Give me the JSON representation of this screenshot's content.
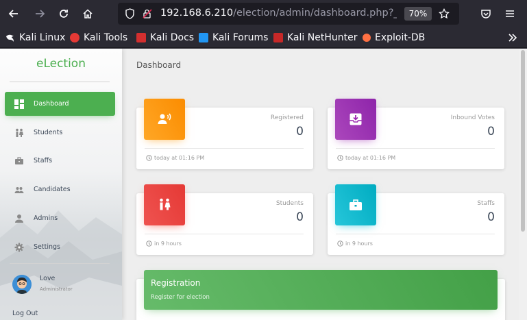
{
  "browser": {
    "url_host": "192.168.6.210",
    "url_path": "/election/admin/dashboard.php?_log",
    "zoom": "70%"
  },
  "bookmarks": [
    {
      "label": "Kali Linux",
      "icon": "kali-dragon-icon"
    },
    {
      "label": "Kali Tools",
      "icon": "kali-tools-icon",
      "color": "#e53935"
    },
    {
      "label": "Kali Docs",
      "icon": "kali-docs-icon",
      "color": "#d32f2f"
    },
    {
      "label": "Kali Forums",
      "icon": "kali-forums-icon",
      "color": "#2196f3"
    },
    {
      "label": "Kali NetHunter",
      "icon": "nethunter-icon",
      "color": "#c62828"
    },
    {
      "label": "Exploit-DB",
      "icon": "exploitdb-icon",
      "color": "#ff7043"
    }
  ],
  "sidebar": {
    "brand": "eLection",
    "items": [
      {
        "label": "Dashboard",
        "icon": "dashboard-icon",
        "active": true
      },
      {
        "label": "Students",
        "icon": "students-icon"
      },
      {
        "label": "Staffs",
        "icon": "staffs-icon"
      },
      {
        "label": "Candidates",
        "icon": "candidates-icon"
      },
      {
        "label": "Admins",
        "icon": "admins-icon"
      },
      {
        "label": "Settings",
        "icon": "settings-icon"
      }
    ],
    "user": {
      "name": "Love",
      "role": "Administrator"
    },
    "logout": "Log Out"
  },
  "main": {
    "title": "Dashboard",
    "cards": [
      {
        "label": "Registered",
        "value": "0",
        "footer": "today at 01:16 PM",
        "color": "#ff9800",
        "icon": "registered-icon"
      },
      {
        "label": "Inbound Votes",
        "value": "0",
        "footer": "today at 01:16 PM",
        "color": "#9c27b0",
        "icon": "inbox-icon"
      },
      {
        "label": "Students",
        "value": "0",
        "footer": "in 9 hours",
        "color": "#f44336",
        "icon": "students-icon"
      },
      {
        "label": "Staffs",
        "value": "0",
        "footer": "in 9 hours",
        "color": "#26c6da",
        "icon": "briefcase-icon"
      }
    ],
    "registration": {
      "title": "Registration",
      "subtitle": "Register for election"
    }
  },
  "colors": {
    "accent": "#4caf50",
    "browser_bg": "#2b2a33"
  }
}
